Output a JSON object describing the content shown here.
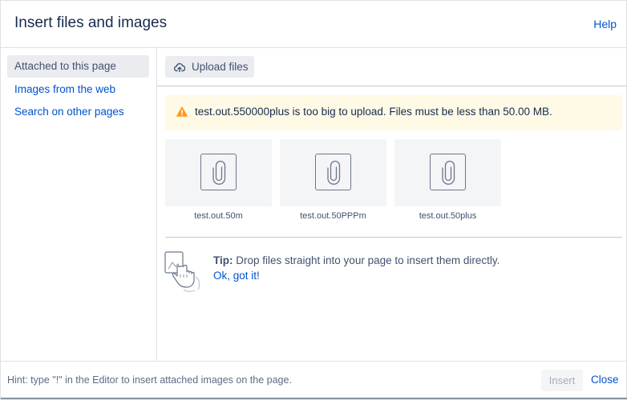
{
  "header": {
    "title": "Insert files and images",
    "help_label": "Help"
  },
  "sidebar": {
    "items": [
      {
        "label": "Attached to this page",
        "active": true
      },
      {
        "label": "Images from the web",
        "active": false
      },
      {
        "label": "Search on other pages",
        "active": false
      }
    ]
  },
  "main": {
    "upload_label": "Upload files",
    "upload_icon": "cloud-upload-icon",
    "warning": {
      "icon": "warning-icon",
      "text": "test.out.550000plus is too big to upload. Files must be less than 50.00 MB."
    },
    "files": [
      {
        "name": "test.out.50m",
        "icon": "paperclip-icon"
      },
      {
        "name": "test.out.50PPPm",
        "icon": "paperclip-icon"
      },
      {
        "name": "test.out.50plus",
        "icon": "paperclip-icon"
      }
    ],
    "tip": {
      "icon": "drag-hand-icon",
      "label": "Tip:",
      "text": " Drop files straight into your page to insert them directly.",
      "link": "Ok, got it!"
    }
  },
  "footer": {
    "hint": "Hint: type \"!\" in the Editor to insert attached images on the page.",
    "insert_label": "Insert",
    "close_label": "Close"
  },
  "colors": {
    "link": "#0052cc",
    "warning_bg": "#fffae6",
    "warning_icon": "#ff991f",
    "tile_bg": "#f4f5f7"
  }
}
